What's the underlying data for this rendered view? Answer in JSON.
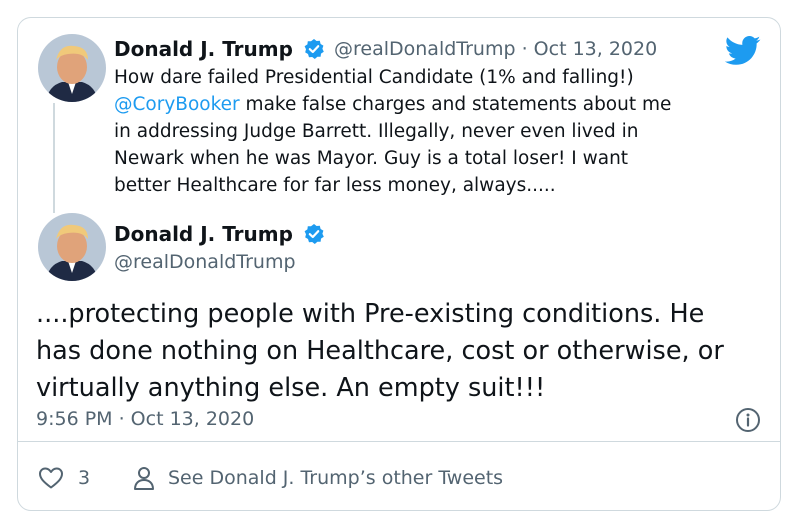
{
  "first_tweet": {
    "name": "Donald J. Trump",
    "handle": "@realDonaldTrump",
    "separator": "·",
    "date": "Oct 13, 2020",
    "text_part1": "How dare failed Presidential Candidate (1% and falling!)",
    "mention": "@CoryBooker",
    "text_part2": " make false charges and statements about me",
    "text_line3": "in addressing Judge Barrett. Illegally, never even lived in",
    "text_line4": "Newark when he was Mayor. Guy is a total loser! I want",
    "text_line5": "better Healthcare for far less money, always....."
  },
  "main_tweet": {
    "name": "Donald J. Trump",
    "handle": "@realDonaldTrump",
    "text_line1": "....protecting people with Pre-existing conditions. He",
    "text_line2": "has done nothing on Healthcare, cost or otherwise, or",
    "text_line3": "virtually anything else. An empty suit!!!",
    "timestamp": "9:56 PM · Oct 13, 2020"
  },
  "footer": {
    "like_count": "3",
    "see_other": "See Donald J. Trump’s other Tweets"
  },
  "icons": {
    "brand": "twitter-bird-icon",
    "verified": "verified-badge-icon",
    "info": "info-icon",
    "like": "heart-icon",
    "profile": "person-icon"
  },
  "colors": {
    "accent": "#1d9bf0",
    "text": "#0f1419",
    "secondary": "#536471",
    "border": "#cfd9de"
  }
}
